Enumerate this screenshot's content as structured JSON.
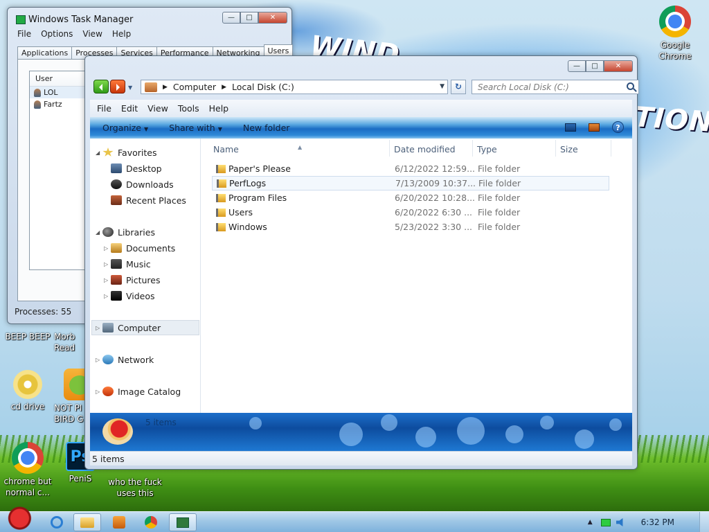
{
  "desktop": {
    "icons": [
      {
        "label": "Google Chrome",
        "icon": "chrome-icon"
      },
      {
        "label": "BEEP BEEP",
        "icon": "app-icon"
      },
      {
        "label": "Morb Read",
        "icon": "app-icon"
      },
      {
        "label": "cd drive",
        "icon": "cd-icon"
      },
      {
        "label": "NOT PI BIRD G",
        "icon": "pig-icon"
      },
      {
        "label": "chrome but normal c...",
        "icon": "chrome-icon"
      },
      {
        "label": "PeniS",
        "icon": "photoshop-icon"
      },
      {
        "label": "who the fuck uses this",
        "icon": "app-icon"
      }
    ]
  },
  "taskmgr": {
    "title": "Windows Task Manager",
    "menu": [
      "File",
      "Options",
      "View",
      "Help"
    ],
    "tabs": [
      "Applications",
      "Processes",
      "Services",
      "Performance",
      "Networking",
      "Users"
    ],
    "active_tab": "Users",
    "column": "User",
    "users": [
      "LOL",
      "Fartz"
    ],
    "status": "Processes: 55"
  },
  "explorer": {
    "breadcrumb": [
      "Computer",
      "Local Disk (C:)"
    ],
    "search_placeholder": "Search Local Disk (C:)",
    "menu": [
      "File",
      "Edit",
      "View",
      "Tools",
      "Help"
    ],
    "commands": [
      "Organize",
      "Share with",
      "New folder"
    ],
    "nav": {
      "favorites": {
        "label": "Favorites",
        "items": [
          "Desktop",
          "Downloads",
          "Recent Places"
        ]
      },
      "libraries": {
        "label": "Libraries",
        "items": [
          "Documents",
          "Music",
          "Pictures",
          "Videos"
        ]
      },
      "computer": "Computer",
      "network": "Network",
      "image_catalog": "Image Catalog"
    },
    "columns": [
      "Name",
      "Date modified",
      "Type",
      "Size"
    ],
    "files": [
      {
        "name": "Paper's Please",
        "date": "6/12/2022 12:59...",
        "type": "File folder"
      },
      {
        "name": "PerfLogs",
        "date": "7/13/2009 10:37...",
        "type": "File folder"
      },
      {
        "name": "Program Files",
        "date": "6/20/2022 10:28...",
        "type": "File folder"
      },
      {
        "name": "Users",
        "date": "6/20/2022 6:30 ...",
        "type": "File folder"
      },
      {
        "name": "Windows",
        "date": "5/23/2022 3:30 ...",
        "type": "File folder"
      }
    ],
    "detail_text": "5 items",
    "status_text": "5 items"
  },
  "taskbar": {
    "clock": "6:32 PM",
    "pinned": [
      "internet-explorer",
      "file-explorer",
      "media-player",
      "chrome",
      "task-manager"
    ]
  },
  "wallpaper_text": [
    "WIND",
    "TION"
  ]
}
